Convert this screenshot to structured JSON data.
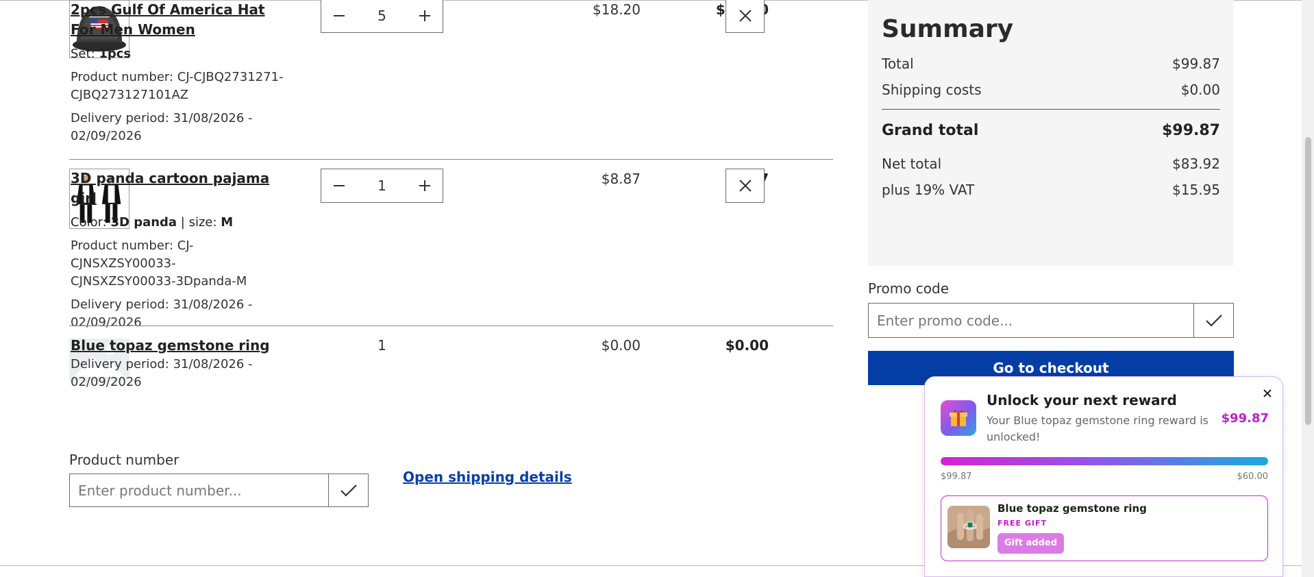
{
  "cart": {
    "items": [
      {
        "name": "2pcs Gulf Of America Hat For Men Women",
        "attr_label": "Set: ",
        "attr_value": "1pcs",
        "product_number": "Product number: CJ-CJBQ2731271-CJBQ273127101AZ",
        "delivery": "Delivery period: 31/08/2026 - 02/09/2026",
        "quantity": "5",
        "unit_price": "$18.20",
        "total_price": "$91.00"
      },
      {
        "name": "3D panda cartoon pajama girl",
        "attr_label": "Color: ",
        "attr_value": "3D panda",
        "attr2_label": " | size: ",
        "attr2_value": "M",
        "product_number": "Product number: CJ-CJNSXZSY00033-CJNSXZSY00033-3Dpanda-M",
        "delivery": "Delivery period: 31/08/2026 - 02/09/2026",
        "quantity": "1",
        "unit_price": "$8.87",
        "total_price": "$8.87"
      },
      {
        "name": "Blue topaz gemstone ring",
        "delivery": "Delivery period: 31/08/2026 - 02/09/2026",
        "quantity": "1",
        "unit_price": "$0.00",
        "total_price": "$0.00"
      }
    ]
  },
  "product_number": {
    "label": "Product number",
    "placeholder": "Enter product number..."
  },
  "shipping_link": "Open shipping details",
  "summary": {
    "title": "Summary",
    "total_label": "Total",
    "total_value": "$99.87",
    "shipping_label": "Shipping costs",
    "shipping_value": "$0.00",
    "grand_label": "Grand total",
    "grand_value": "$99.87",
    "net_label": "Net total",
    "net_value": "$83.92",
    "vat_label": "plus 19% VAT",
    "vat_value": "$15.95"
  },
  "promo": {
    "label": "Promo code",
    "placeholder": "Enter promo code..."
  },
  "checkout_label": "Go to checkout",
  "reward": {
    "title": "Unlock your next reward",
    "subtitle": "Your Blue topaz gemstone ring reward is unlocked!",
    "amount": "$99.87",
    "progress_start": "$99.87",
    "progress_end": "$60.00",
    "progress_fraction": 1.0,
    "gift_name": "Blue topaz gemstone ring",
    "gift_tag": "FREE GIFT",
    "gift_status": "Gift added"
  },
  "colors": {
    "checkout_bg": "#043ea5",
    "link": "#0a3fa8",
    "reward_accent": "#c21ccd"
  },
  "icons": [
    "minus-icon",
    "plus-icon",
    "close-icon",
    "checkmark-icon",
    "gift-icon",
    "image-placeholder-icon"
  ]
}
